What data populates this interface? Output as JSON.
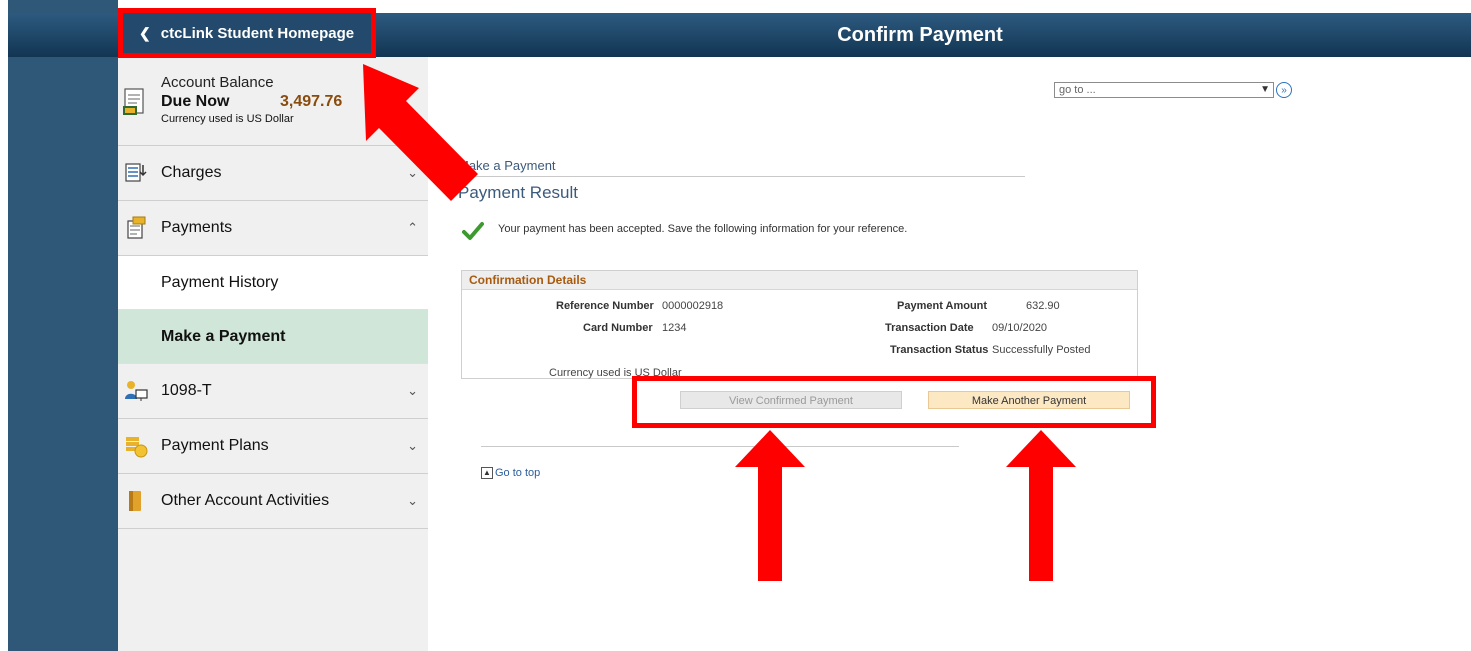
{
  "header": {
    "back_label": "ctcLink Student Homepage",
    "title": "Confirm Payment"
  },
  "sidebar": {
    "balance": {
      "title": "Account Balance",
      "due_label": "Due Now",
      "amount": "3,497.76",
      "currency": "Currency used is US Dollar"
    },
    "items": [
      {
        "label": "Charges"
      },
      {
        "label": "Payments"
      },
      {
        "label": "Payment History"
      },
      {
        "label": "Make a Payment"
      },
      {
        "label": "1098-T"
      },
      {
        "label": "Payment Plans"
      },
      {
        "label": "Other Account Activities"
      }
    ]
  },
  "goto": {
    "value": "go to ..."
  },
  "main": {
    "breadcrumb": "Make a Payment",
    "result_title": "Payment Result",
    "message": "Your payment has been accepted. Save the following information for your reference.",
    "details": {
      "header": "Confirmation Details",
      "ref_label": "Reference Number",
      "ref_value": "0000002918",
      "card_label": "Card Number",
      "card_value": "1234",
      "amount_label": "Payment Amount",
      "amount_value": "632.90",
      "date_label": "Transaction Date",
      "date_value": "09/10/2020",
      "status_label": "Transaction Status",
      "status_value": "Successfully Posted",
      "currency_note": "Currency used is US Dollar"
    },
    "buttons": {
      "view_confirmed": "View Confirmed Payment",
      "make_another": "Make Another Payment"
    },
    "go_to_top": "Go to top"
  },
  "colors": {
    "banner": "#1b3f5f",
    "annotation": "#ff0000",
    "active_item": "#cfe6d8",
    "amount": "#8a4b0e"
  }
}
